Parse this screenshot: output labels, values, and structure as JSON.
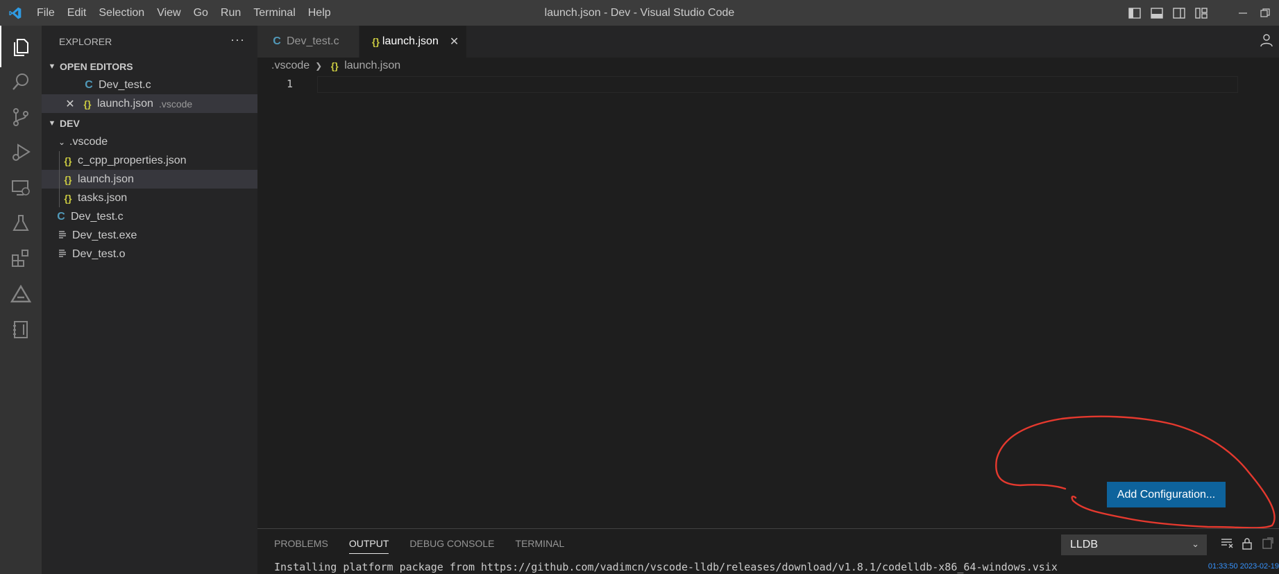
{
  "window": {
    "title": "launch.json - Dev - Visual Studio Code",
    "menu": [
      "File",
      "Edit",
      "Selection",
      "View",
      "Go",
      "Run",
      "Terminal",
      "Help"
    ]
  },
  "activity_bar": {
    "icons": [
      "explorer-icon",
      "search-icon",
      "source-control-icon",
      "run-debug-icon",
      "remote-explorer-icon",
      "testing-icon",
      "extensions-icon",
      "deploy-icon",
      "notebook-icon"
    ]
  },
  "sidebar": {
    "title": "EXPLORER",
    "more": "···",
    "open_editors": {
      "title": "OPEN EDITORS",
      "items": [
        {
          "icon": "C",
          "name": "Dev_test.c",
          "desc": ""
        },
        {
          "icon": "{}",
          "name": "launch.json",
          "desc": ".vscode"
        }
      ]
    },
    "folder": {
      "title": "DEV",
      "subfolder": ".vscode",
      "subfolder_files": [
        "c_cpp_properties.json",
        "launch.json",
        "tasks.json"
      ],
      "files": [
        "Dev_test.c",
        "Dev_test.exe",
        "Dev_test.o"
      ]
    }
  },
  "tabs": [
    {
      "label": "Dev_test.c",
      "icon": "C"
    },
    {
      "label": "launch.json",
      "icon": "{}",
      "close": "✕"
    }
  ],
  "breadcrumb": {
    "folder": ".vscode",
    "file": "launch.json"
  },
  "editor": {
    "line_number": "1"
  },
  "add_configuration_button": "Add Configuration...",
  "panel": {
    "tabs": [
      "PROBLEMS",
      "OUTPUT",
      "DEBUG CONSOLE",
      "TERMINAL"
    ],
    "active_tab": "OUTPUT",
    "channel": "LLDB",
    "output_line": "Installing platform package from https://github.com/vadimcn/vscode-lldb/releases/download/v1.8.1/codelldb-x86_64-windows.vsix",
    "timestamp": "01:33:50 2023-02-19"
  },
  "colors": {
    "accent": "#0e639c",
    "annotation": "#e5392e",
    "c_icon": "#519aba",
    "json_icon": "#cbcb41"
  }
}
